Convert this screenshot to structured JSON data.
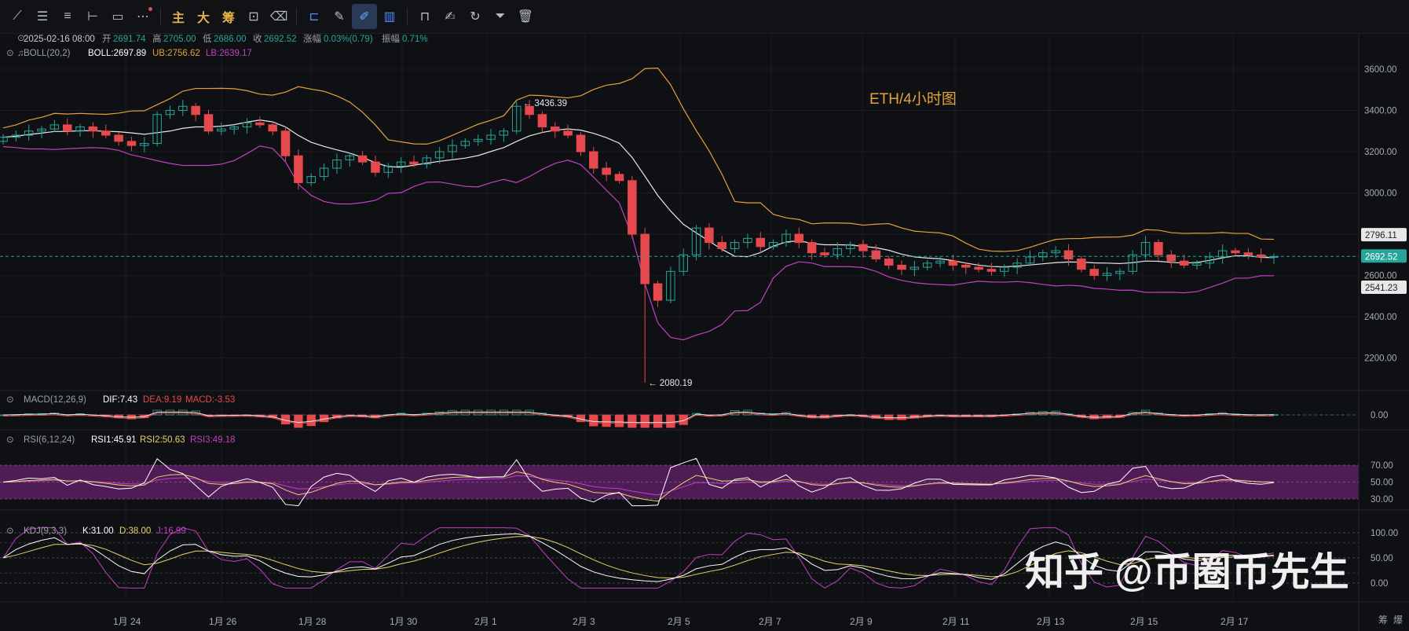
{
  "toolbar": {
    "text_buttons": [
      "主",
      "大",
      "筹"
    ]
  },
  "header": {
    "date": "2025-02-16 08:00",
    "open_label": "开",
    "open": "2691.74",
    "high_label": "高",
    "high": "2705.00",
    "low_label": "低",
    "low": "2686.00",
    "close_label": "收",
    "close": "2692.52",
    "chg_label": "涨幅",
    "chg": "0.03%(0.79)",
    "amp_label": "振幅",
    "amp": "0.71%"
  },
  "boll_legend": {
    "name": "BOLL(20,2)",
    "mid": "BOLL:2697.89",
    "ub": "UB:2756.62",
    "lb": "LB:2639.17"
  },
  "macd_legend": {
    "name": "MACD(12,26,9)",
    "dif": "DIF:7.43",
    "dea": "DEA:9.19",
    "macd": "MACD:-3.53"
  },
  "rsi_legend": {
    "name": "RSI(6,12,24)",
    "r1": "RSI1:45.91",
    "r2": "RSI2:50.63",
    "r3": "RSI3:49.18"
  },
  "kdj_legend": {
    "name": "KDJ(9,3,3)",
    "k": "K:31.00",
    "d": "D:38.00",
    "j": "J:16.99"
  },
  "annotation_title": "ETH/4小时图",
  "watermark": "知乎 @币圈币先生",
  "bottom_right": [
    "筹",
    "爆"
  ],
  "colors": {
    "up": "#26a69a",
    "down": "#e6494d",
    "boll_mid": "#e8e8e8",
    "boll_ub": "#e3a23a",
    "boll_lb": "#c33fc4",
    "rsi1": "#ffffff",
    "rsi2": "#e8d36a",
    "rsi3": "#c33fc4",
    "rsi_band": "#5b1f63"
  },
  "chart_data": [
    {
      "type": "candlestick",
      "x_ticks": [
        "1月 24",
        "1月 26",
        "1月 28",
        "1月 30",
        "2月 1",
        "2月 3",
        "2月 5",
        "2月 7",
        "2月 9",
        "2月 11",
        "2月 13",
        "2月 15",
        "2月 17"
      ],
      "y_ticks": [
        2200,
        2400,
        2600,
        2800,
        3000,
        3200,
        3400,
        3600
      ],
      "ylim": [
        2050,
        3680
      ],
      "price_tags": {
        "ub": "2796.11",
        "last": "2692.52",
        "lb": "2541.23"
      },
      "annotations": [
        {
          "text": "← 3436.39",
          "value": 3436.39
        },
        {
          "text": "← 2080.19",
          "value": 2080.19
        }
      ],
      "close_path": [
        3270,
        3280,
        3300,
        3310,
        3330,
        3300,
        3320,
        3300,
        3280,
        3250,
        3230,
        3240,
        3380,
        3400,
        3420,
        3380,
        3300,
        3310,
        3320,
        3340,
        3330,
        3300,
        3180,
        3050,
        3080,
        3120,
        3160,
        3180,
        3150,
        3100,
        3130,
        3150,
        3140,
        3170,
        3200,
        3230,
        3250,
        3260,
        3280,
        3300,
        3420,
        3380,
        3320,
        3300,
        3280,
        3200,
        3120,
        3090,
        3060,
        2800,
        2560,
        2480,
        2620,
        2700,
        2830,
        2760,
        2730,
        2760,
        2780,
        2740,
        2760,
        2800,
        2760,
        2710,
        2700,
        2730,
        2750,
        2720,
        2680,
        2650,
        2630,
        2640,
        2660,
        2670,
        2650,
        2640,
        2630,
        2620,
        2640,
        2660,
        2690,
        2710,
        2720,
        2680,
        2630,
        2600,
        2610,
        2620,
        2700,
        2760,
        2700,
        2670,
        2650,
        2660,
        2690,
        2720,
        2710,
        2700,
        2690,
        2692
      ]
    },
    {
      "type": "bar",
      "name": "MACD",
      "y_ticks": [
        "0.00"
      ]
    },
    {
      "type": "line",
      "name": "RSI",
      "y_ticks": [
        "70.00",
        "50.00",
        "30.00"
      ],
      "ylim": [
        20,
        80
      ]
    },
    {
      "type": "line",
      "name": "KDJ",
      "y_ticks": [
        "100.00",
        "50.00",
        "0.00"
      ],
      "ylim": [
        -15,
        115
      ]
    }
  ]
}
